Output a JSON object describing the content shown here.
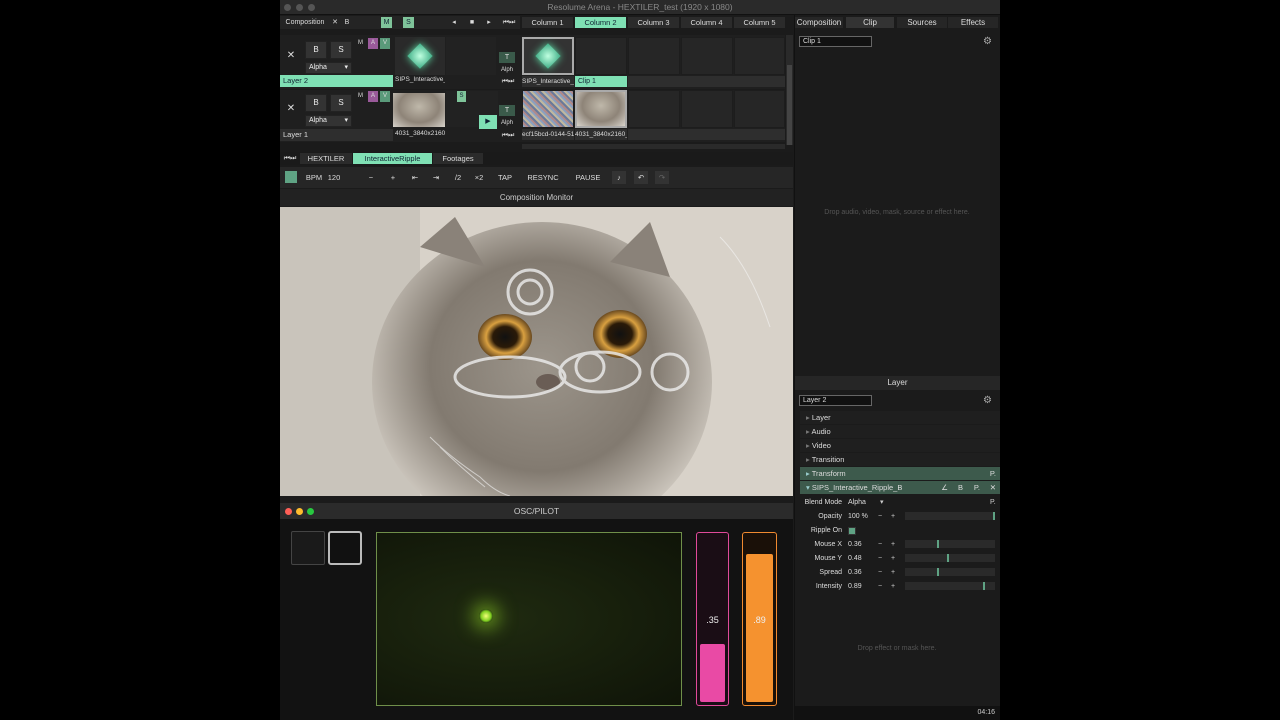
{
  "window": {
    "title": "Resolume Arena - HEXTILER_test (1920 x 1080)"
  },
  "menubar": {
    "composition": "Composition",
    "x": "✕",
    "b": "B",
    "m": "M",
    "s": "S"
  },
  "columns": [
    "Column 1",
    "Column 2",
    "Column 3",
    "Column 4",
    "Column 5"
  ],
  "layers": [
    {
      "name": "Layer 2",
      "blend": "Alpha",
      "b": "B",
      "s": "S",
      "clip_name": "SIPS_Interactive_R...",
      "clip2": "SIPS_Interactive_R...",
      "clip_label": "Clip 1",
      "alpha": "Alph",
      "t": "T"
    },
    {
      "name": "Layer 1",
      "blend": "Alpha",
      "b": "B",
      "s": "S",
      "clip_name": "4031_3840x2160_...",
      "clip1": "ecf15bcd-0144-51...",
      "clip2": "4031_3840x2160_...",
      "alpha": "Alph",
      "t": "T"
    }
  ],
  "layer_toggles": {
    "m": "M",
    "a": "A",
    "v": "V"
  },
  "deck_tabs": [
    "HEXTILER",
    "InteractiveRipple",
    "Footages"
  ],
  "transport": {
    "bpm_label": "BPM",
    "bpm": "120",
    "minus": "−",
    "plus": "+",
    "half": "/2",
    "double": "×2",
    "tap": "TAP",
    "resync": "RESYNC",
    "pause": "PAUSE"
  },
  "monitor": {
    "title": "Composition Monitor"
  },
  "osc": {
    "title": "OSC/PILOT",
    "fader1_value": ".35",
    "fader2_value": ".89",
    "fader1_level": 0.35,
    "fader2_level": 0.89,
    "xy_x": 0.36,
    "xy_y": 0.48
  },
  "right_tabs": [
    "Composition",
    "Clip",
    "Sources",
    "Effects"
  ],
  "clip_panel": {
    "name": "Clip 1",
    "drop_hint": "Drop audio, video, mask, source or effect here."
  },
  "layer_panel": {
    "header": "Layer",
    "name": "Layer 2",
    "sections": [
      "Layer",
      "Audio",
      "Video",
      "Transition"
    ],
    "transform": "Transform",
    "effect_name": "SIPS_Interactive_Ripple_B",
    "effect_btns": [
      "∠",
      "B",
      "P.",
      "✕"
    ],
    "p": "P.",
    "blend_label": "Blend Mode",
    "blend_value": "Alpha",
    "opacity": {
      "label": "Opacity",
      "value": "100 %",
      "level": 1.0
    },
    "ripple": {
      "label": "Ripple On"
    },
    "params": [
      {
        "label": "Mouse X",
        "value": "0.36",
        "level": 0.36
      },
      {
        "label": "Mouse Y",
        "value": "0.48",
        "level": 0.48
      },
      {
        "label": "Spread",
        "value": "0.36",
        "level": 0.36
      },
      {
        "label": "Intensity",
        "value": "0.89",
        "level": 0.89
      }
    ],
    "drop_hint": "Drop effect or mask here."
  },
  "status": {
    "time": "04:16"
  }
}
